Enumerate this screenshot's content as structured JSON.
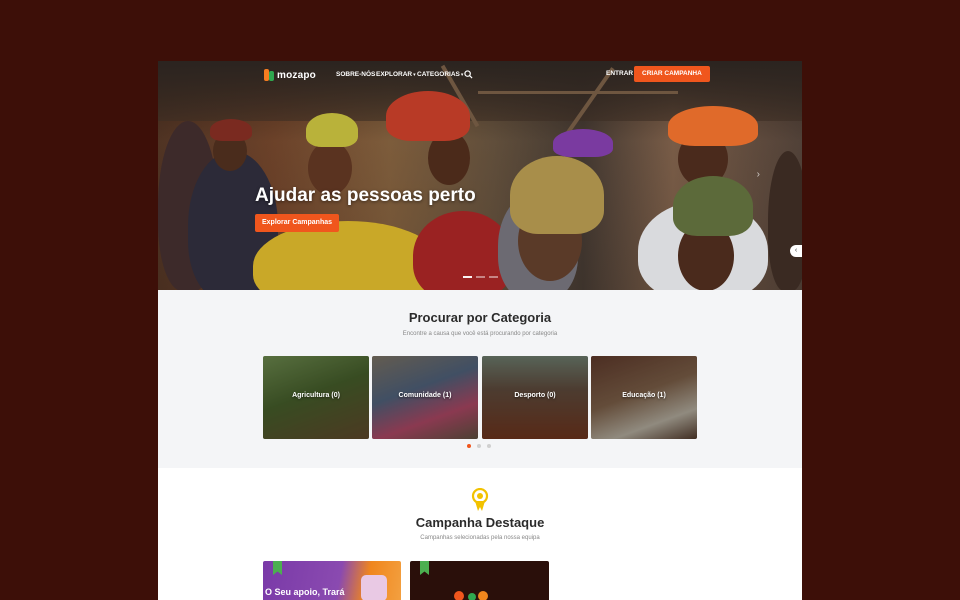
{
  "nav": {
    "logo": "mozapo",
    "links": [
      {
        "label": "SOBRE-NÓS",
        "caret": ""
      },
      {
        "label": "EXPLORAR",
        "caret": "▾"
      },
      {
        "label": "CATEGORIAS",
        "caret": "▾"
      }
    ],
    "login": "ENTRAR",
    "create": "CRIAR CAMPANHA"
  },
  "hero": {
    "title": "Ajudar as pessoas perto",
    "cta": "Explorar Campanhas"
  },
  "categories": {
    "title": "Procurar por Categoria",
    "subtitle": "Encontre a causa que você está procurando por categoria",
    "items": [
      {
        "label": "Agricultura (0)"
      },
      {
        "label": "Comunidade (1)"
      },
      {
        "label": "Desporto (0)"
      },
      {
        "label": "Educação (1)"
      }
    ]
  },
  "featured": {
    "title": "Campanha Destaque",
    "subtitle": "Campanhas selecionadas pela nossa equipa",
    "card1_text": "O Seu apoio, Trará"
  },
  "colors": {
    "accent": "#f0561d",
    "brand_green": "#2fa84f",
    "background": "#3d0f08"
  }
}
